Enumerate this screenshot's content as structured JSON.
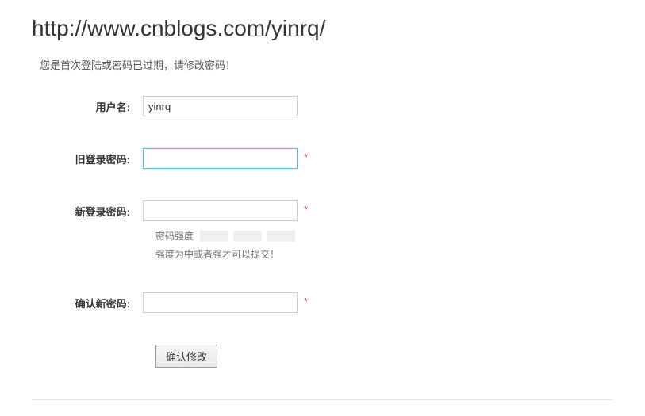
{
  "url": "http://www.cnblogs.com/yinrq/",
  "notice": "您是首次登陆或密码已过期，请修改密码！",
  "form": {
    "username_label": "用户名:",
    "username_value": "yinrq",
    "old_password_label": "旧登录密码:",
    "new_password_label": "新登录密码:",
    "confirm_password_label": "确认新密码:",
    "required_mark": "*",
    "strength_label": "密码强度",
    "strength_hint": "强度为中或者强才可以提交！",
    "submit_label": "确认修改"
  }
}
